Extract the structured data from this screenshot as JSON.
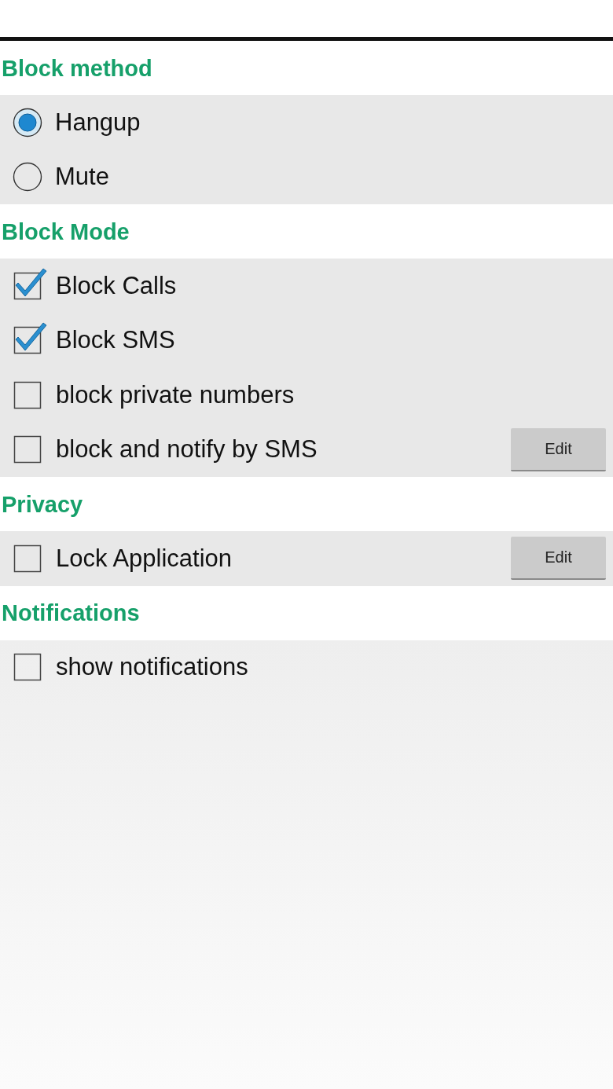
{
  "sections": [
    {
      "title": "Block method",
      "items": [
        {
          "kind": "radio",
          "label": "Hangup",
          "selected": true
        },
        {
          "kind": "radio",
          "label": "Mute",
          "selected": false
        }
      ]
    },
    {
      "title": "Block Mode",
      "items": [
        {
          "kind": "checkbox",
          "label": "Block Calls",
          "checked": true
        },
        {
          "kind": "checkbox",
          "label": "Block SMS",
          "checked": true
        },
        {
          "kind": "checkbox",
          "label": "block private numbers",
          "checked": false
        },
        {
          "kind": "checkbox",
          "label": "block and notify by SMS",
          "checked": false,
          "button": "Edit"
        }
      ]
    },
    {
      "title": "Privacy",
      "items": [
        {
          "kind": "checkbox",
          "label": "Lock Application",
          "checked": false,
          "button": "Edit"
        }
      ]
    },
    {
      "title": "Notifications",
      "items": [
        {
          "kind": "checkbox",
          "label": "show notifications",
          "checked": false
        }
      ]
    }
  ]
}
